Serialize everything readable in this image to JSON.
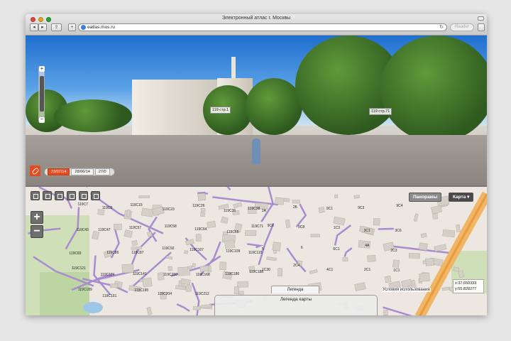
{
  "window": {
    "title": "Электронный атлас г. Москвы",
    "url": "eatlas.mos.ru",
    "reader_label": "Reader",
    "share_icon": "share-icon",
    "add_icon": "plus-icon"
  },
  "panorama": {
    "labels": [
      {
        "text": "119 стр.1"
      },
      {
        "text": "119 стр.71"
      }
    ],
    "zoom": {
      "plus": "+",
      "minus": "−"
    },
    "dates": [
      "23/07/14",
      "28/06/14",
      "27/0"
    ],
    "active_date_index": 0
  },
  "map": {
    "tools": [
      "home-icon",
      "minus-icon",
      "ruler-icon",
      "area-icon",
      "person-icon",
      "grid-icon"
    ],
    "zoom_in": "+",
    "zoom_out": "−",
    "layers": {
      "panoramas": "Панорамы",
      "map": "Карта"
    },
    "legend_tab": "Легенда",
    "legend_title": "Легенда карты",
    "terms": "Условия использования",
    "coords": {
      "x": "x:37.650333",
      "y": "y:55.828277"
    },
    "labels": [
      "119С7",
      "119С8",
      "119С15",
      "119С23",
      "119С26",
      "119С36",
      "119С38",
      "119С43",
      "119С47",
      "119С57",
      "119С58",
      "119С64",
      "119С65",
      "119С71",
      "119С83",
      "119С86",
      "119С87",
      "119С92",
      "119С107",
      "119С109",
      "119С115",
      "119С121",
      "119С124",
      "119С141",
      "119С150",
      "119С168",
      "119С186",
      "119С188",
      "119С189",
      "119С191",
      "119С195",
      "119С204",
      "119С212",
      "119С219",
      "2А",
      "2Б",
      "9С1",
      "9С3",
      "9С4",
      "9С6",
      "9С8",
      "1С3",
      "3С1",
      "3С6",
      "5",
      "6",
      "6С1",
      "4А",
      "2С3",
      "1С30",
      "2С4",
      "4С1",
      "2С1",
      "1С1"
    ]
  }
}
